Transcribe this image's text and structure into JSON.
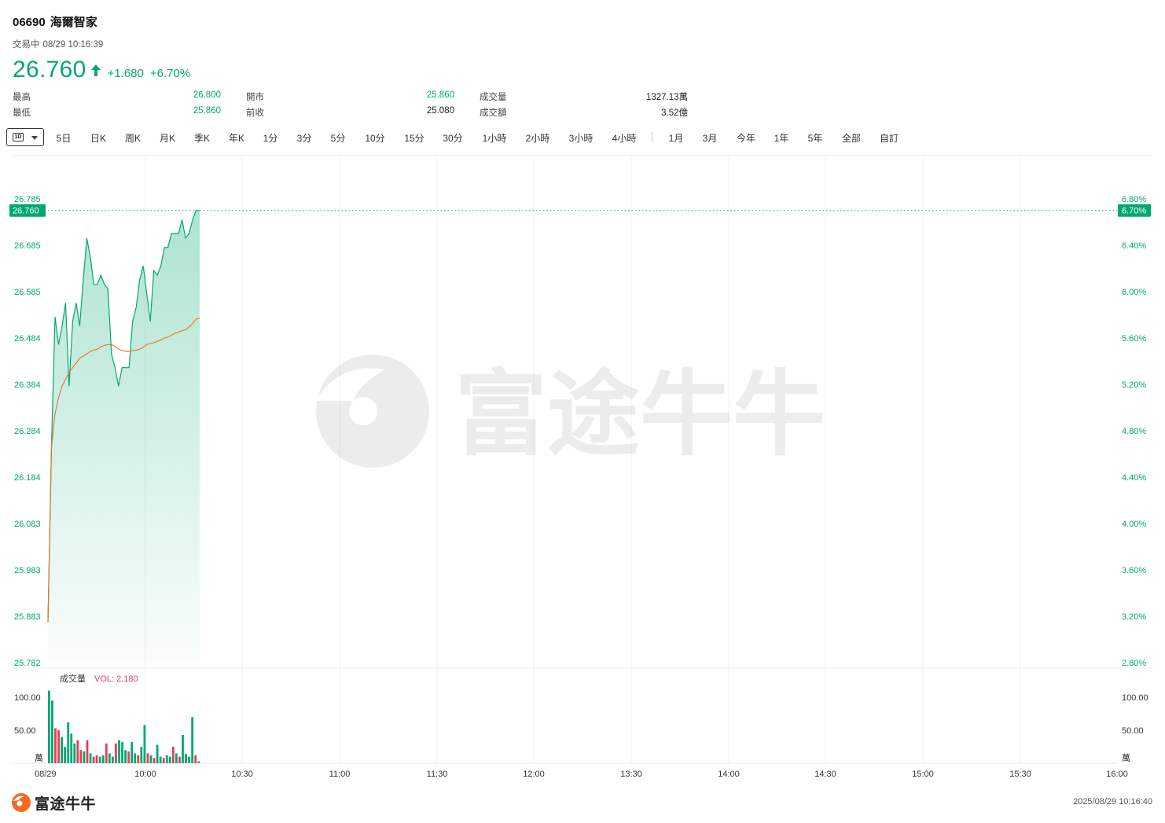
{
  "header": {
    "code": "06690",
    "name": "海爾智家",
    "status": "交易中",
    "datetime": "08/29 10:16:39",
    "price": "26.760",
    "change": "+1.680",
    "change_pct": "+6.70%",
    "accent_color": "#00a870"
  },
  "stats": {
    "high_label": "最高",
    "high_value": "26.800",
    "low_label": "最低",
    "low_value": "25.860",
    "open_label": "開市",
    "open_value": "25.860",
    "prev_close_label": "前收",
    "prev_close_value": "25.080",
    "volume_label": "成交量",
    "volume_value": "1327.13萬",
    "turnover_label": "成交額",
    "turnover_value": "3.52億"
  },
  "toolbar": {
    "period_badge": "1D",
    "items": [
      "5日",
      "日K",
      "周K",
      "月K",
      "季K",
      "年K",
      "1分",
      "3分",
      "5分",
      "10分",
      "15分",
      "30分",
      "1小時",
      "2小時",
      "3小時",
      "4小時",
      "1月",
      "3月",
      "今年",
      "1年",
      "5年",
      "全部",
      "自訂"
    ]
  },
  "footer": {
    "brand": "富途牛牛",
    "timestamp": "2025/08/29 10:16:40"
  },
  "chart_data": {
    "type": "line",
    "price_axis": {
      "ticks": [
        "26.785",
        "26.685",
        "26.585",
        "26.484",
        "26.384",
        "26.284",
        "26.184",
        "26.083",
        "25.983",
        "25.883",
        "25.782"
      ],
      "range": [
        25.782,
        26.785
      ]
    },
    "pct_axis": {
      "ticks": [
        "6.80%",
        "6.40%",
        "6.00%",
        "5.60%",
        "5.20%",
        "4.80%",
        "4.40%",
        "4.00%",
        "3.60%",
        "3.20%",
        "2.80%"
      ]
    },
    "current_price_label": "26.760",
    "current_pct_label": "6.70%",
    "x_ticks": [
      "08/29",
      "10:00",
      "10:30",
      "11:00",
      "11:30",
      "12:00",
      "13:30",
      "14:00",
      "14:30",
      "15:00",
      "15:30",
      "16:00"
    ],
    "price_series": {
      "name": "",
      "color": "#00a870",
      "values": [
        25.87,
        26.25,
        26.53,
        26.47,
        26.51,
        26.56,
        26.38,
        26.52,
        26.56,
        26.51,
        26.61,
        26.7,
        26.66,
        26.6,
        26.6,
        26.62,
        26.6,
        26.59,
        26.45,
        26.42,
        26.38,
        26.42,
        26.42,
        26.42,
        26.52,
        26.55,
        26.61,
        26.64,
        26.58,
        26.52,
        26.63,
        26.62,
        26.64,
        26.68,
        26.68,
        26.71,
        26.71,
        26.71,
        26.74,
        26.7,
        26.71,
        26.74,
        26.76,
        26.76
      ]
    },
    "avg_series": {
      "name": "",
      "color": "#e8731a",
      "values": [
        25.87,
        26.25,
        26.32,
        26.355,
        26.38,
        26.395,
        26.41,
        26.42,
        26.43,
        26.44,
        26.445,
        26.45,
        26.455,
        26.458,
        26.46,
        26.465,
        26.468,
        26.47,
        26.47,
        26.466,
        26.46,
        26.457,
        26.455,
        26.455,
        26.457,
        26.458,
        26.46,
        26.464,
        26.47,
        26.472,
        26.474,
        26.477,
        26.48,
        26.484,
        26.486,
        26.49,
        26.494,
        26.497,
        26.5,
        26.502,
        26.508,
        26.515,
        26.525,
        26.527
      ]
    },
    "volume": {
      "label": "成交量",
      "vol_text": "VOL: 2.180",
      "unit": "萬",
      "ticks": [
        "100.00",
        "50.00"
      ],
      "ylim": [
        0,
        100
      ],
      "up_color": "#00a870",
      "down_color": "#e0405a",
      "values": [
        110,
        95,
        53,
        50,
        40,
        25,
        62,
        45,
        30,
        35,
        20,
        18,
        35,
        15,
        10,
        12,
        10,
        12,
        30,
        15,
        10,
        30,
        35,
        32,
        20,
        18,
        32,
        15,
        12,
        25,
        58,
        15,
        12,
        8,
        28,
        10,
        8,
        12,
        10,
        25,
        15,
        10,
        43,
        14,
        10,
        70,
        12,
        3
      ],
      "up": [
        1,
        1,
        0,
        0,
        1,
        1,
        1,
        1,
        1,
        0,
        0,
        1,
        0,
        1,
        0,
        0,
        1,
        1,
        0,
        1,
        1,
        0,
        1,
        1,
        1,
        0,
        1,
        1,
        0,
        1,
        1,
        0,
        1,
        0,
        1,
        1,
        0,
        1,
        1,
        0,
        1,
        0,
        1,
        1,
        1,
        1,
        0,
        0
      ]
    },
    "watermark": "富途牛牛",
    "grid": true
  }
}
